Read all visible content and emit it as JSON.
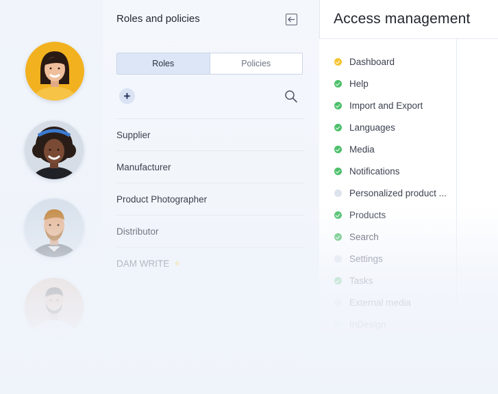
{
  "avatars": [
    {
      "name": "avatar-woman-yellow"
    },
    {
      "name": "avatar-woman-curly"
    },
    {
      "name": "avatar-man-beard"
    },
    {
      "name": "avatar-man-white-shirt"
    }
  ],
  "roles_panel": {
    "title": "Roles and policies",
    "tabs": [
      {
        "label": "Roles",
        "active": true
      },
      {
        "label": "Policies",
        "active": false
      }
    ],
    "add_label": "+",
    "roles": [
      {
        "label": "Supplier"
      },
      {
        "label": "Manufacturer"
      },
      {
        "label": "Product Photographer"
      },
      {
        "label": "Distributor"
      },
      {
        "label": "DAM WRITE"
      }
    ]
  },
  "access_panel": {
    "title": "Access management",
    "permissions": [
      {
        "label": "Dashboard",
        "status": "yellow"
      },
      {
        "label": "Help",
        "status": "green"
      },
      {
        "label": "Import and Export",
        "status": "green"
      },
      {
        "label": "Languages",
        "status": "green"
      },
      {
        "label": "Media",
        "status": "green"
      },
      {
        "label": "Notifications",
        "status": "green"
      },
      {
        "label": "Personalized product ...",
        "status": "grey"
      },
      {
        "label": "Products",
        "status": "green"
      },
      {
        "label": "Search",
        "status": "green"
      },
      {
        "label": "Settings",
        "status": "grey"
      },
      {
        "label": "Tasks",
        "status": "green"
      },
      {
        "label": "External media",
        "status": "grey"
      },
      {
        "label": "InDesign",
        "status": "grey"
      }
    ]
  },
  "colors": {
    "accent_tab": "#dce6f7",
    "check_green": "#4cbf6a",
    "check_yellow": "#f4c430",
    "neutral_dot": "#dde3ec"
  }
}
